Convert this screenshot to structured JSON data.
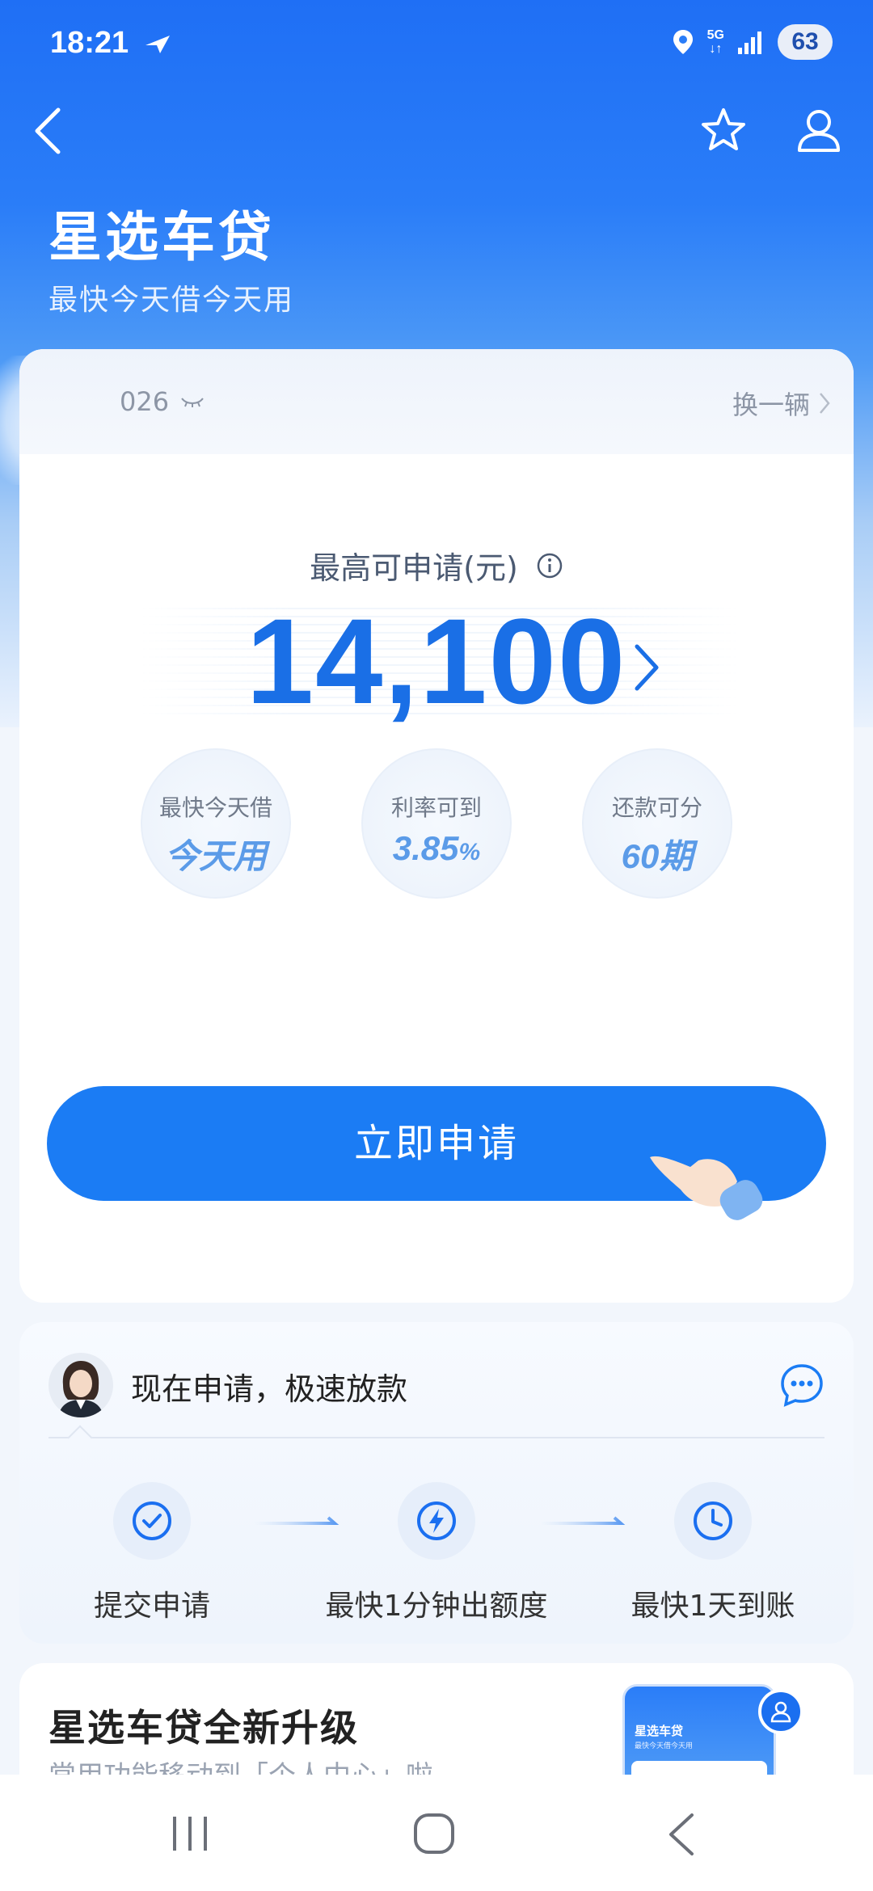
{
  "status_bar": {
    "time": "18:21",
    "network_top": "5G",
    "network_bottom": "↓↑",
    "battery": "63"
  },
  "header": {
    "title": "星选车贷",
    "subtitle": "最快今天借今天用",
    "icons": [
      "back-icon",
      "star-icon",
      "user-icon"
    ]
  },
  "card": {
    "plate_suffix": "026",
    "switch_label": "换一辆",
    "limit_label": "最高可申请(元)",
    "amount": "14,100",
    "features": [
      {
        "label": "最快今天借",
        "value": "今天用"
      },
      {
        "label": "利率可到",
        "value": "3.85",
        "unit": "%"
      },
      {
        "label": "还款可分",
        "value": "60期"
      }
    ],
    "apply_button": "立即申请"
  },
  "steps": {
    "headline": "现在申请，极速放款",
    "items": [
      {
        "label": "提交申请",
        "icon": "check-icon"
      },
      {
        "label": "最快1分钟出额度",
        "icon": "lightning-icon"
      },
      {
        "label": "最快1天到账",
        "icon": "clock-icon"
      }
    ]
  },
  "upgrade": {
    "title": "星选车贷全新升级",
    "subtitle": "常用功能移动到「个人中心」啦",
    "mini_title": "星选车贷",
    "mini_subtitle": "最快今天借今天用"
  },
  "colors": {
    "primary": "#1b7cf4",
    "amount": "#1a6fe6",
    "header_blue": "#1f6ff5"
  }
}
